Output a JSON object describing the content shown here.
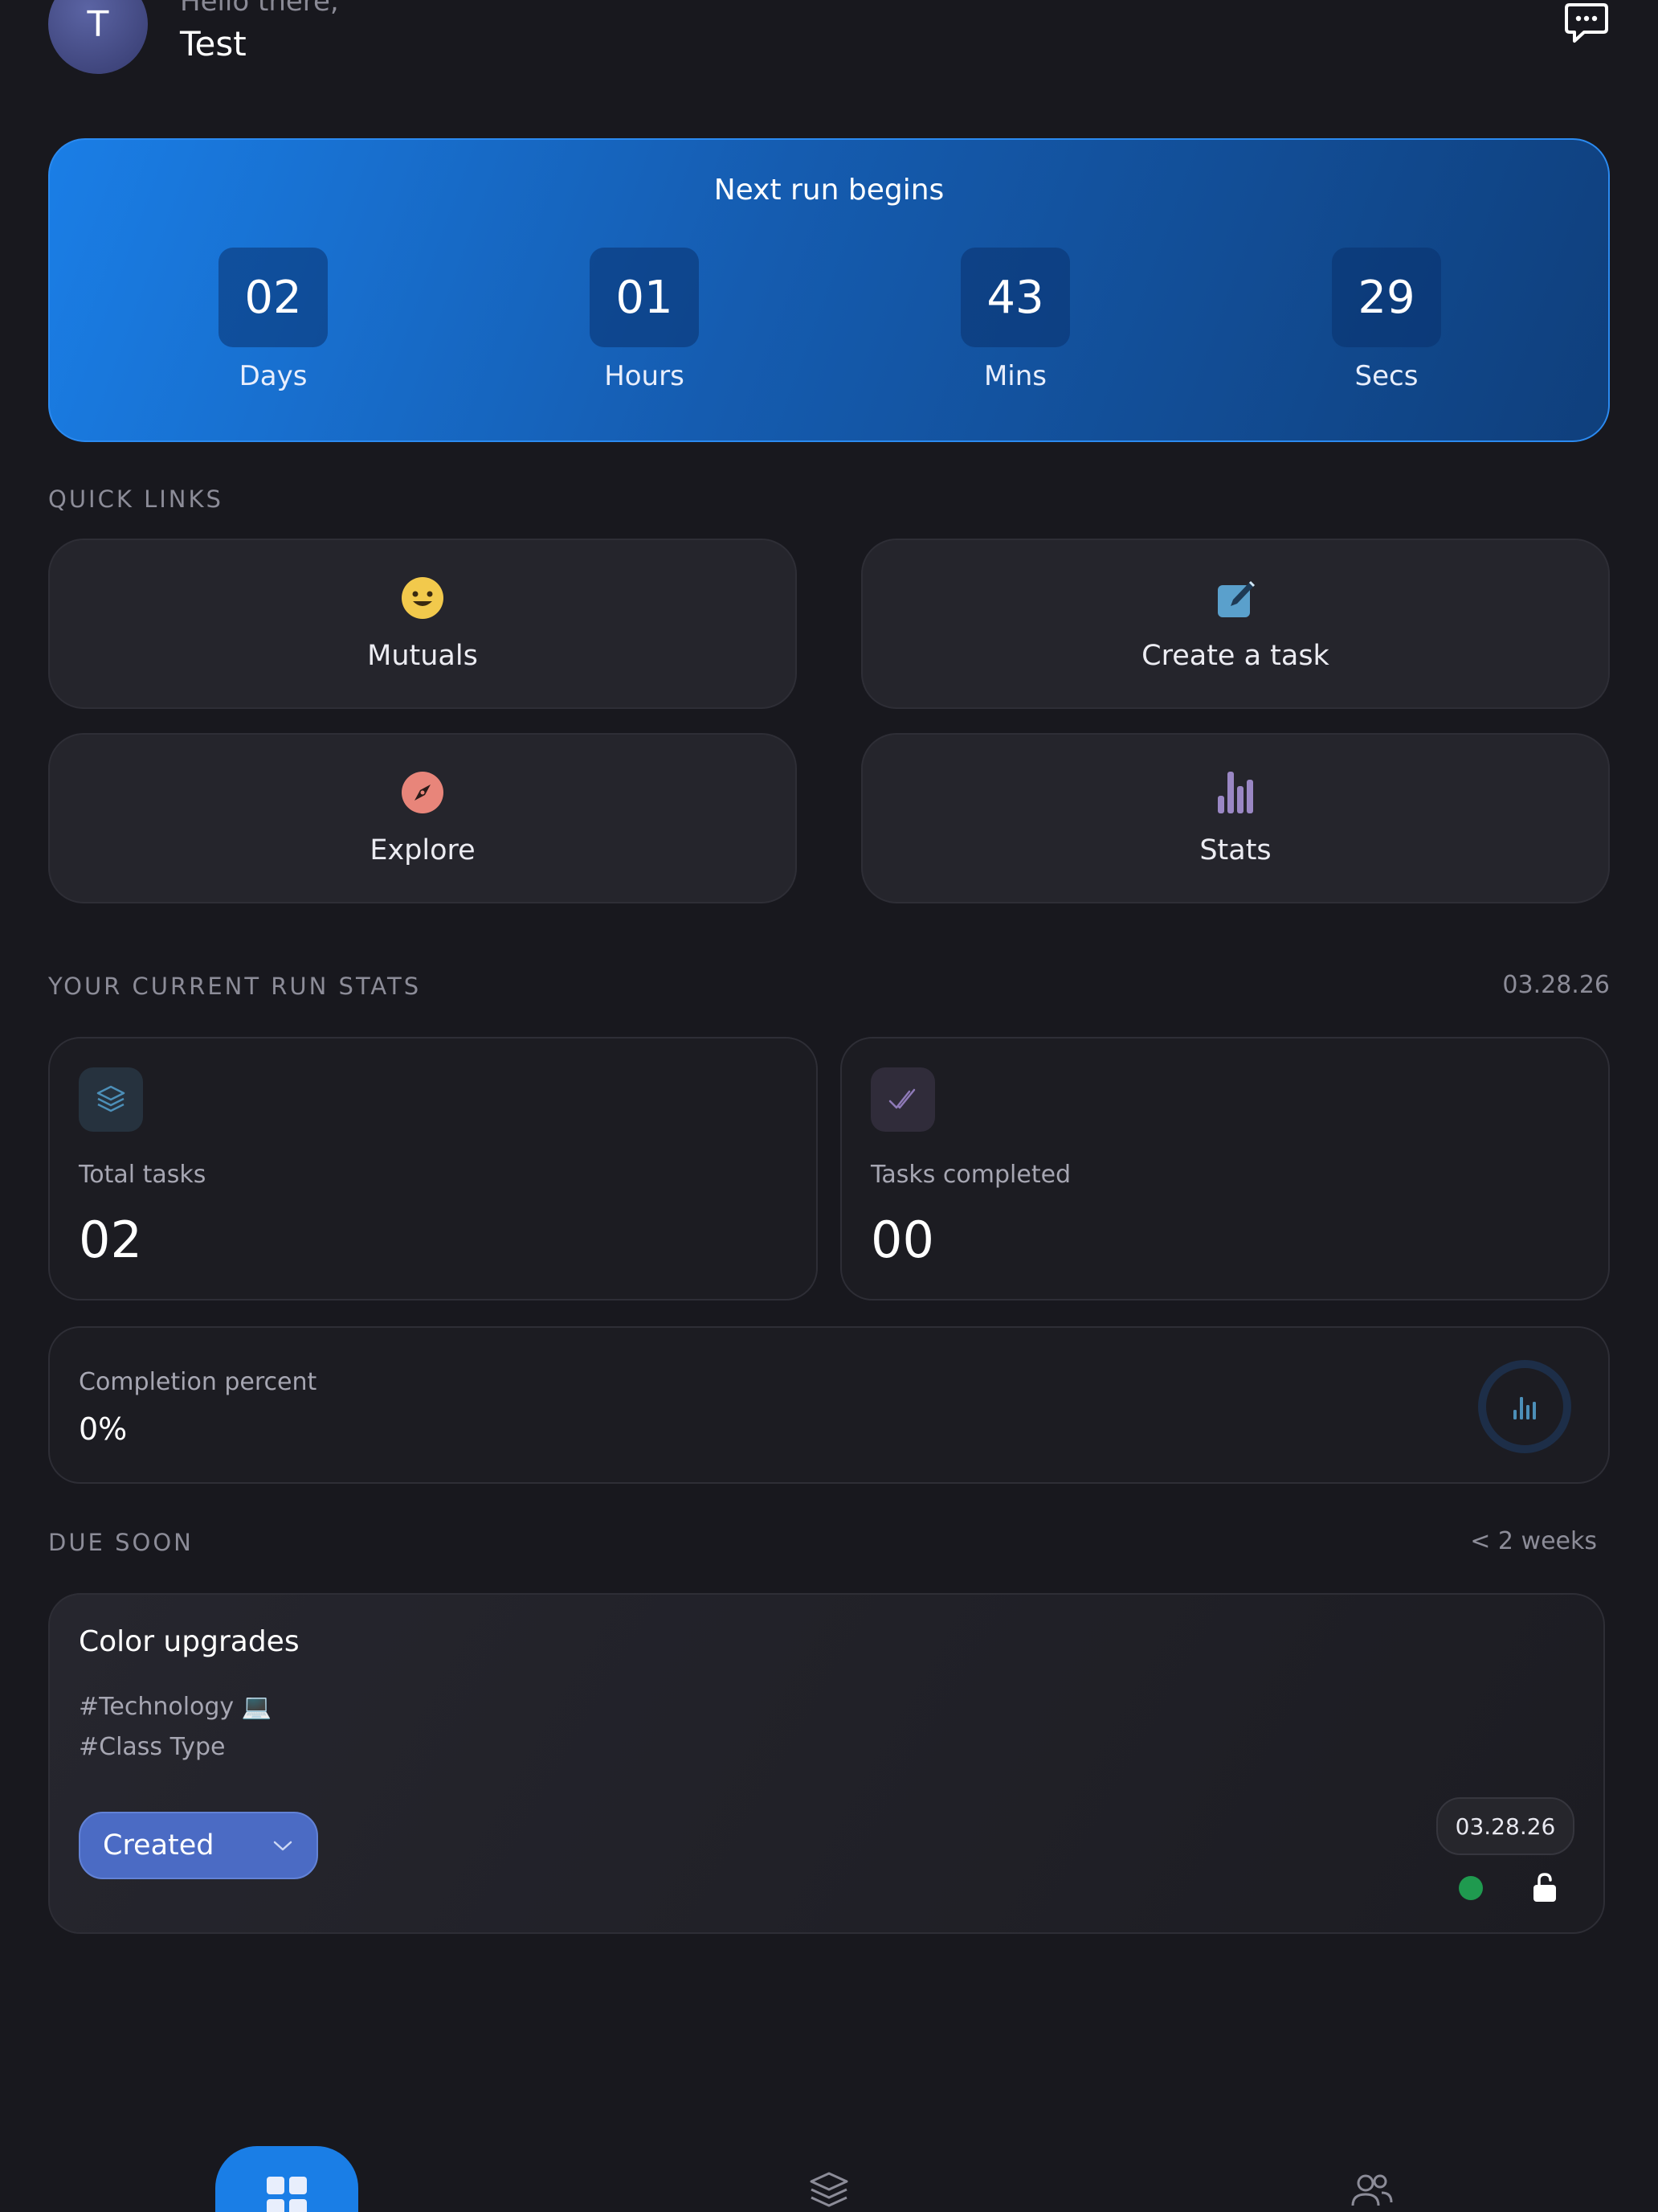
{
  "header": {
    "avatar_initial": "T",
    "greeting": "Hello there,",
    "username": "Test",
    "chat_icon": "chat-bubble-icon"
  },
  "countdown": {
    "title": "Next run begins",
    "units": [
      {
        "value": "02",
        "label": "Days"
      },
      {
        "value": "01",
        "label": "Hours"
      },
      {
        "value": "43",
        "label": "Mins"
      },
      {
        "value": "29",
        "label": "Secs"
      }
    ]
  },
  "quick_links": {
    "title": "QUICK LINKS",
    "items": [
      {
        "label": "Mutuals",
        "icon": "smiley-icon",
        "color": "#f2c94c"
      },
      {
        "label": "Create a task",
        "icon": "edit-note-icon",
        "color": "#5aa0cc"
      },
      {
        "label": "Explore",
        "icon": "compass-icon",
        "color": "#e8857a"
      },
      {
        "label": "Stats",
        "icon": "bar-chart-icon",
        "color": "#9a87c4"
      }
    ]
  },
  "run_stats": {
    "title": "YOUR CURRENT RUN STATS",
    "date": "03.28.26",
    "total_label": "Total tasks",
    "total_value": "02",
    "completed_label": "Tasks completed",
    "completed_value": "00",
    "completion_label": "Completion percent",
    "completion_value": "0%"
  },
  "due_soon": {
    "title": "DUE SOON",
    "range": "< 2 weeks",
    "task": {
      "title": "Color upgrades",
      "tags": [
        "#Technology 💻",
        "#Class Type"
      ],
      "status": "Created",
      "date": "03.28.26"
    }
  },
  "colors": {
    "accent": "#1a7ee6",
    "status_select": "#4b6bc4",
    "status_dot": "#1f9a4f"
  }
}
